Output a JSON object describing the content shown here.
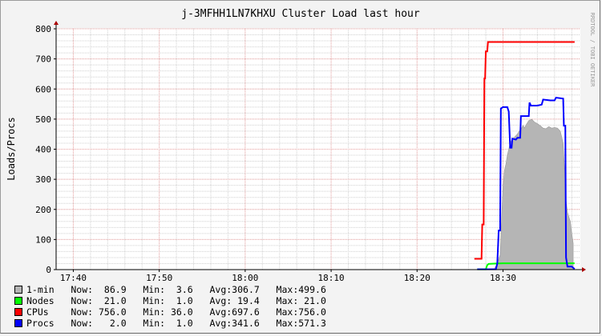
{
  "watermark": "RRDTOOL / TOBI OETIKER",
  "chart_data": {
    "type": "area",
    "title": "j-3MFHH1LN7KHXU Cluster Load last hour",
    "ylabel": "Loads/Procs",
    "xlabel": "",
    "x_time_range": [
      "17:38",
      "18:39"
    ],
    "ylim": [
      0,
      800
    ],
    "yticks": [
      0,
      100,
      200,
      300,
      400,
      500,
      600,
      700,
      800
    ],
    "xticks": [
      "17:40",
      "17:50",
      "18:00",
      "18:10",
      "18:20",
      "18:30"
    ],
    "grid": true,
    "colors": {
      "background": "#f3f3f3",
      "plot": "#ffffff",
      "major_grid": "#e8a0a0",
      "minor_grid": "#d0d0d0",
      "axis": "#000000",
      "arrow": "#aa0000"
    },
    "series": [
      {
        "name": "1-min",
        "color": "#b5b5b5",
        "stroke": "#9a9a9a",
        "style": "area",
        "points": [
          [
            "18:27",
            0
          ],
          [
            "18:28",
            2
          ],
          [
            "18:29",
            3.6
          ],
          [
            "18:29:20",
            20
          ],
          [
            "18:29:40",
            50
          ],
          [
            "18:29:50",
            170
          ],
          [
            "18:30",
            275
          ],
          [
            "18:30:10",
            330
          ],
          [
            "18:30:20",
            350
          ],
          [
            "18:30:30",
            380
          ],
          [
            "18:30:40",
            400
          ],
          [
            "18:30:50",
            420
          ],
          [
            "18:31",
            430
          ],
          [
            "18:31:20",
            440
          ],
          [
            "18:31:40",
            450
          ],
          [
            "18:32",
            465
          ],
          [
            "18:32:10",
            470
          ],
          [
            "18:32:20",
            480
          ],
          [
            "18:32:30",
            470
          ],
          [
            "18:32:40",
            480
          ],
          [
            "18:33",
            495
          ],
          [
            "18:33:20",
            499.6
          ],
          [
            "18:33:40",
            490
          ],
          [
            "18:34",
            485
          ],
          [
            "18:34:20",
            478
          ],
          [
            "18:34:40",
            470
          ],
          [
            "18:35",
            468
          ],
          [
            "18:35:20",
            475
          ],
          [
            "18:35:40",
            470
          ],
          [
            "18:36",
            472
          ],
          [
            "18:36:20",
            470
          ],
          [
            "18:36:40",
            460
          ],
          [
            "18:37",
            420
          ],
          [
            "18:37:10",
            330
          ],
          [
            "18:37:20",
            230
          ],
          [
            "18:37:30",
            190
          ],
          [
            "18:37:40",
            175
          ],
          [
            "18:37:50",
            160
          ],
          [
            "18:38",
            120
          ],
          [
            "18:38:10",
            86.9
          ]
        ]
      },
      {
        "name": "Nodes",
        "color": "#00ff00",
        "style": "line",
        "points": [
          [
            "18:27",
            1
          ],
          [
            "18:28",
            1
          ],
          [
            "18:28:10",
            15
          ],
          [
            "18:28:20",
            19
          ],
          [
            "18:29",
            20
          ],
          [
            "18:30",
            21
          ],
          [
            "18:38:20",
            21
          ]
        ]
      },
      {
        "name": "CPUs",
        "color": "#ff0000",
        "style": "line",
        "points": [
          [
            "18:26:40",
            36
          ],
          [
            "18:27:30",
            36
          ],
          [
            "18:27:35",
            150
          ],
          [
            "18:27:45",
            150
          ],
          [
            "18:27:50",
            635
          ],
          [
            "18:27:55",
            635
          ],
          [
            "18:28",
            725
          ],
          [
            "18:28:10",
            725
          ],
          [
            "18:28:15",
            756
          ],
          [
            "18:38:20",
            756
          ]
        ]
      },
      {
        "name": "Procs",
        "color": "#0000ff",
        "style": "line",
        "points": [
          [
            "18:27",
            1
          ],
          [
            "18:29:10",
            1
          ],
          [
            "18:29:20",
            20
          ],
          [
            "18:29:30",
            130
          ],
          [
            "18:29:40",
            130
          ],
          [
            "18:29:45",
            535
          ],
          [
            "18:30",
            540
          ],
          [
            "18:30:30",
            540
          ],
          [
            "18:30:40",
            525
          ],
          [
            "18:30:50",
            405
          ],
          [
            "18:31",
            405
          ],
          [
            "18:31:05",
            435
          ],
          [
            "18:31:30",
            432
          ],
          [
            "18:31:40",
            438
          ],
          [
            "18:32",
            438
          ],
          [
            "18:32:05",
            510
          ],
          [
            "18:33",
            510
          ],
          [
            "18:33:05",
            555
          ],
          [
            "18:33:15",
            545
          ],
          [
            "18:34",
            545
          ],
          [
            "18:34:30",
            548
          ],
          [
            "18:34:40",
            565
          ],
          [
            "18:35:30",
            562
          ],
          [
            "18:36",
            562
          ],
          [
            "18:36:10",
            571.3
          ],
          [
            "18:37",
            568
          ],
          [
            "18:37:05",
            478
          ],
          [
            "18:37:15",
            478
          ],
          [
            "18:37:20",
            40
          ],
          [
            "18:37:30",
            10
          ],
          [
            "18:38",
            10
          ],
          [
            "18:38:20",
            2
          ]
        ]
      }
    ],
    "legend": [
      {
        "name": "1-min",
        "color": "#b5b5b5",
        "now": "86.9",
        "min": "3.6",
        "avg": "306.7",
        "max": "499.6"
      },
      {
        "name": "Nodes",
        "color": "#00ff00",
        "now": "21.0",
        "min": "1.0",
        "avg": "19.4",
        "max": "21.0"
      },
      {
        "name": "CPUs",
        "color": "#ff0000",
        "now": "756.0",
        "min": "36.0",
        "avg": "697.6",
        "max": "756.0"
      },
      {
        "name": "Procs",
        "color": "#0000ff",
        "now": "2.0",
        "min": "1.0",
        "avg": "341.6",
        "max": "571.3"
      }
    ]
  }
}
